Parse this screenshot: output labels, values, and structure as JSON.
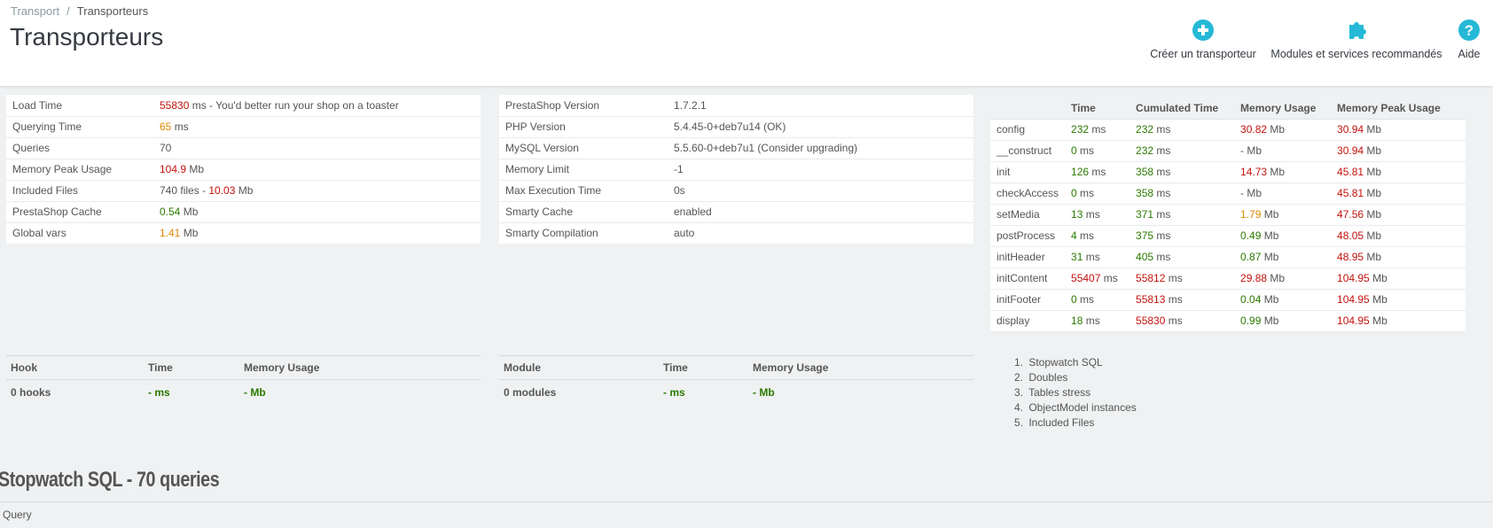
{
  "breadcrumb": {
    "parent": "Transport",
    "separator": "/",
    "current": "Transporteurs"
  },
  "page_title": "Transporteurs",
  "toolbar": {
    "create_label": "Créer un transporteur",
    "modules_label": "Modules et services recommandés",
    "help_label": "Aide"
  },
  "colors": {
    "accent": "#25b9d7",
    "red": "#c4120d",
    "orange": "#e08a00",
    "green": "#2b7a00"
  },
  "load_summary": {
    "load_time_label": "Load Time",
    "load_time_value": "55830",
    "load_time_suffix": " ms - You'd better run your shop on a toaster",
    "querying_time_label": "Querying Time",
    "querying_time_value": "65",
    "querying_time_unit": " ms",
    "queries_label": "Queries",
    "queries_value": "70",
    "memory_peak_label": "Memory Peak Usage",
    "memory_peak_value": "104.9",
    "memory_peak_unit": " Mb",
    "included_files_label": "Included Files",
    "included_files_count": "740 files - ",
    "included_files_size": "10.03",
    "included_files_unit": " Mb",
    "cache_label": "PrestaShop Cache",
    "cache_value": "0.54",
    "cache_unit": " Mb",
    "global_vars_label": "Global vars",
    "global_vars_value": "1.41",
    "global_vars_unit": " Mb"
  },
  "server_info": {
    "ps_version_label": "PrestaShop Version",
    "ps_version_value": "1.7.2.1",
    "php_label": "PHP Version",
    "php_value": "5.4.45-0+deb7u14 (OK)",
    "mysql_label": "MySQL Version",
    "mysql_value": "5.5.60-0+deb7u1 (Consider upgrading)",
    "memory_limit_label": "Memory Limit",
    "memory_limit_value": "-1",
    "max_exec_label": "Max Execution Time",
    "max_exec_value": "0s",
    "smarty_cache_label": "Smarty Cache",
    "smarty_cache_value": "enabled",
    "smarty_compile_label": "Smarty Compilation",
    "smarty_compile_value": "auto"
  },
  "controller_table": {
    "headers": [
      "",
      "Time",
      "Cumulated Time",
      "Memory Usage",
      "Memory Peak Usage"
    ],
    "rows": [
      {
        "name": "config",
        "time": "232",
        "cumulated": "232",
        "memory": "30.82",
        "peak": "30.94",
        "tc": "green",
        "cc": "green",
        "mc": "red",
        "pc": "red"
      },
      {
        "name": "__construct",
        "time": "0",
        "cumulated": "232",
        "memory": "-",
        "peak": "30.94",
        "tc": "green",
        "cc": "green",
        "mc": "unit",
        "pc": "red"
      },
      {
        "name": "init",
        "time": "126",
        "cumulated": "358",
        "memory": "14.73",
        "peak": "45.81",
        "tc": "green",
        "cc": "green",
        "mc": "red",
        "pc": "red"
      },
      {
        "name": "checkAccess",
        "time": "0",
        "cumulated": "358",
        "memory": "-",
        "peak": "45.81",
        "tc": "green",
        "cc": "green",
        "mc": "unit",
        "pc": "red"
      },
      {
        "name": "setMedia",
        "time": "13",
        "cumulated": "371",
        "memory": "1.79",
        "peak": "47.56",
        "tc": "green",
        "cc": "green",
        "mc": "orange",
        "pc": "red"
      },
      {
        "name": "postProcess",
        "time": "4",
        "cumulated": "375",
        "memory": "0.49",
        "peak": "48.05",
        "tc": "green",
        "cc": "green",
        "mc": "green",
        "pc": "red"
      },
      {
        "name": "initHeader",
        "time": "31",
        "cumulated": "405",
        "memory": "0.87",
        "peak": "48.95",
        "tc": "green",
        "cc": "green",
        "mc": "green",
        "pc": "red"
      },
      {
        "name": "initContent",
        "time": "55407",
        "cumulated": "55812",
        "memory": "29.88",
        "peak": "104.95",
        "tc": "red",
        "cc": "red",
        "mc": "red",
        "pc": "red"
      },
      {
        "name": "initFooter",
        "time": "0",
        "cumulated": "55813",
        "memory": "0.04",
        "peak": "104.95",
        "tc": "green",
        "cc": "red",
        "mc": "green",
        "pc": "red"
      },
      {
        "name": "display",
        "time": "18",
        "cumulated": "55830",
        "memory": "0.99",
        "peak": "104.95",
        "tc": "green",
        "cc": "red",
        "mc": "green",
        "pc": "red"
      }
    ],
    "ms_unit": " ms",
    "mb_unit": " Mb"
  },
  "hooks_table": {
    "h1": "Hook",
    "h2": "Time",
    "h3": "Memory Usage",
    "c1": "0 hooks",
    "c2": "- ms",
    "c3": "- Mb"
  },
  "modules_table": {
    "h1": "Module",
    "h2": "Time",
    "h3": "Memory Usage",
    "c1": "0 modules",
    "c2": "- ms",
    "c3": "- Mb"
  },
  "toc": [
    {
      "num": "1.",
      "label": "Stopwatch SQL"
    },
    {
      "num": "2.",
      "label": "Doubles"
    },
    {
      "num": "3.",
      "label": "Tables stress"
    },
    {
      "num": "4.",
      "label": "ObjectModel instances"
    },
    {
      "num": "5.",
      "label": "Included Files"
    }
  ],
  "stopwatch": {
    "title": "Stopwatch SQL - 70 queries",
    "query_header": "Query"
  }
}
